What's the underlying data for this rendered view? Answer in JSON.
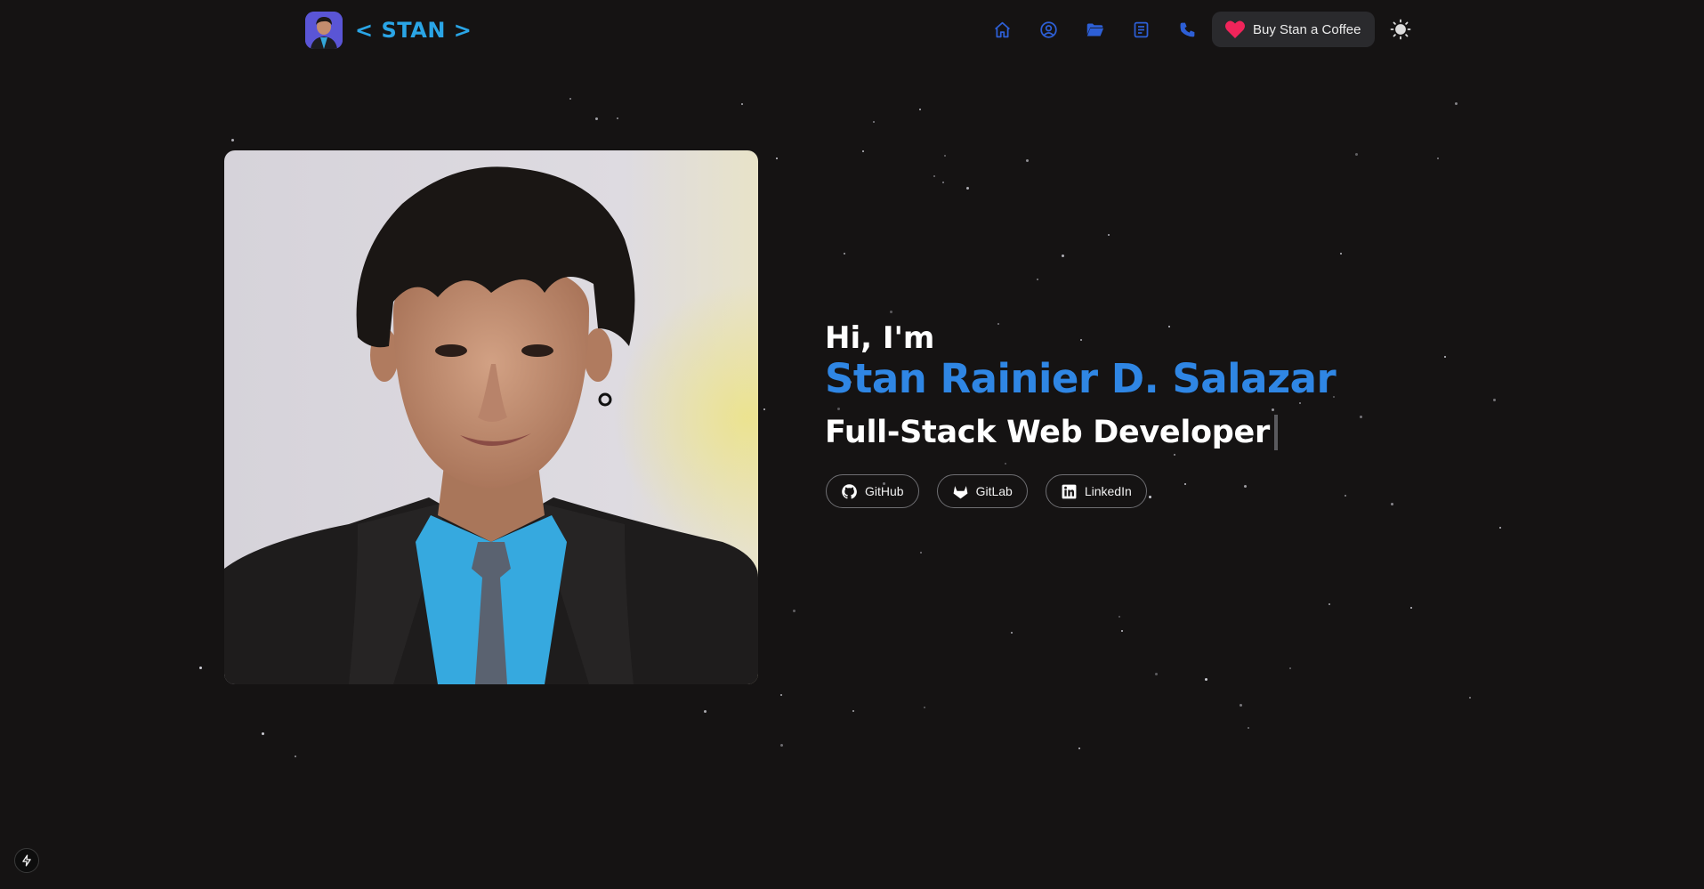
{
  "header": {
    "brand_text": "< STAN >",
    "nav": [
      {
        "icon": "home-icon"
      },
      {
        "icon": "user-circle-icon"
      },
      {
        "icon": "folder-icon"
      },
      {
        "icon": "document-icon"
      },
      {
        "icon": "phone-icon"
      }
    ],
    "coffee_label": "Buy Stan a Coffee",
    "theme_icon": "sun-icon"
  },
  "hero": {
    "greeting": "Hi, I'm",
    "name": "Stan Rainier D. Salazar",
    "role": "Full-Stack Web Developer"
  },
  "socials": [
    {
      "label": "GitHub",
      "icon": "github-icon"
    },
    {
      "label": "GitLab",
      "icon": "gitlab-icon"
    },
    {
      "label": "LinkedIn",
      "icon": "linkedin-icon"
    }
  ],
  "colors": {
    "background": "#151313",
    "accent_blue": "#2f86e4",
    "brand_blue": "#2aa5e6",
    "nav_icon_blue": "#2d5fd6",
    "heart_red": "#f0245a"
  }
}
